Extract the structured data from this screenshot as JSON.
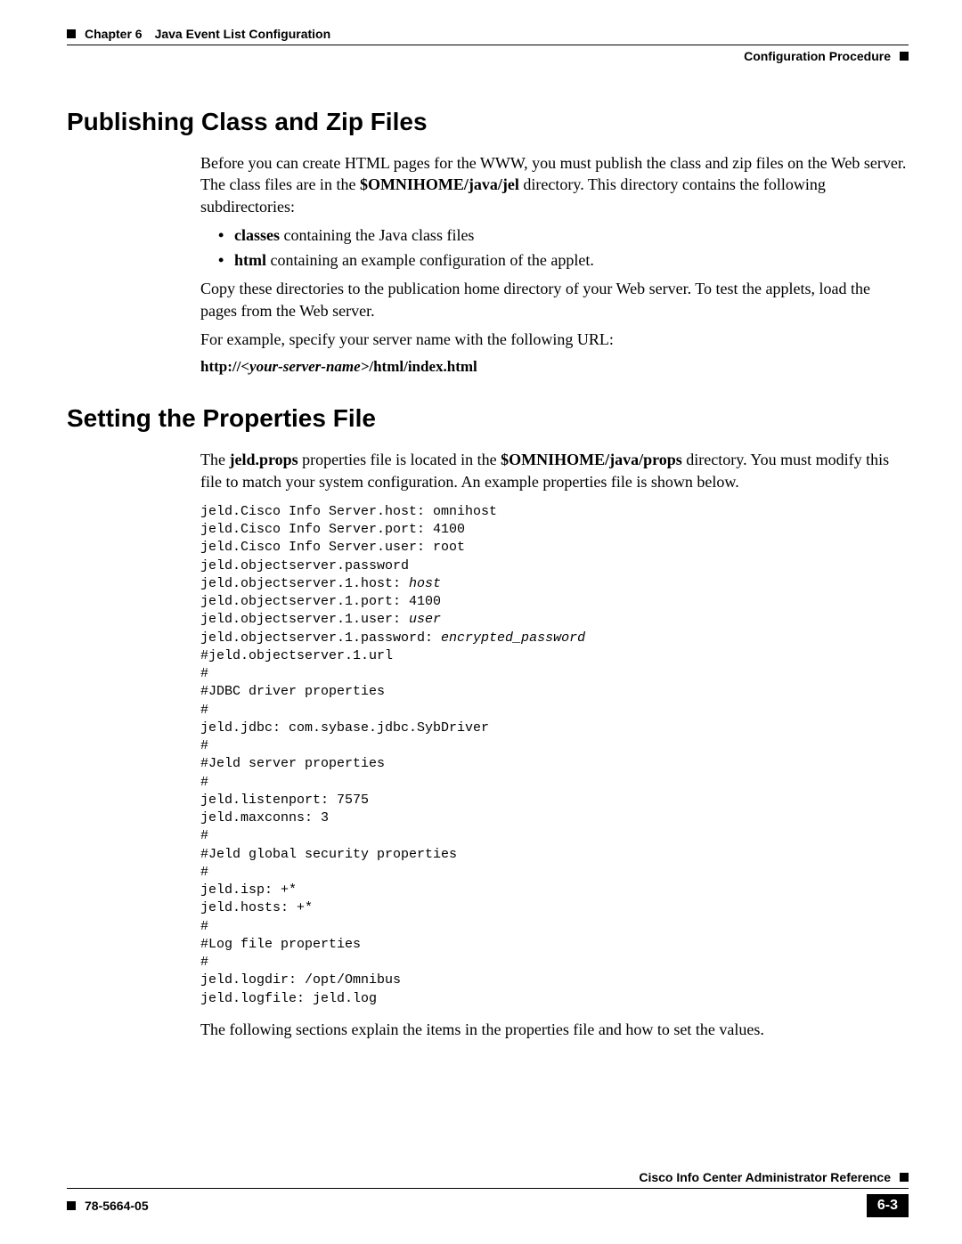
{
  "header": {
    "chapter_label": "Chapter 6",
    "chapter_title": "Java Event List Configuration",
    "section_title": "Configuration Procedure"
  },
  "section1": {
    "title": "Publishing Class and Zip Files",
    "p1_a": "Before you can create HTML pages for the WWW, you must publish the class and zip files on the Web server. The class files are in the ",
    "p1_b": "$OMNIHOME/java/jel",
    "p1_c": " directory. This directory contains the following subdirectories:",
    "li1_b": "classes",
    "li1_t": " containing the Java class files",
    "li2_b": "html",
    "li2_t": " containing an example configuration of the applet.",
    "p2": "Copy these directories to the publication home directory of your Web server. To test the applets, load the pages from the Web server.",
    "p3": "For example, specify your server name with the following URL:",
    "url_a": "http://",
    "url_b": "<your-server-name>",
    "url_c": "/html/index.html"
  },
  "section2": {
    "title": "Setting the Properties File",
    "p1_a": "The ",
    "p1_b": "jeld.props",
    "p1_c": " properties file is located in the ",
    "p1_d": "$OMNIHOME/java/props",
    "p1_e": " directory. You must modify this file to match your system configuration. An example properties file is shown below.",
    "code": {
      "l1": "jeld.Cisco Info Server.host: omnihost",
      "l2": "jeld.Cisco Info Server.port: 4100",
      "l3": "jeld.Cisco Info Server.user: root",
      "l4": "jeld.objectserver.password",
      "l5a": "jeld.objectserver.1.host: ",
      "l5b": "host",
      "l6": "jeld.objectserver.1.port: 4100",
      "l7a": "jeld.objectserver.1.user: ",
      "l7b": "user",
      "l8a": "jeld.objectserver.1.password: ",
      "l8b": "encrypted_password",
      "l9": "#jeld.objectserver.1.url",
      "l10": "#",
      "l11": "#JDBC driver properties",
      "l12": "#",
      "l13": "jeld.jdbc: com.sybase.jdbc.SybDriver",
      "l14": "#",
      "l15": "#Jeld server properties",
      "l16": "#",
      "l17": "jeld.listenport: 7575",
      "l18": "jeld.maxconns: 3",
      "l19": "#",
      "l20": "#Jeld global security properties",
      "l21": "#",
      "l22": "jeld.isp: +*",
      "l23": "jeld.hosts: +*",
      "l24": "#",
      "l25": "#Log file properties",
      "l26": "#",
      "l27": "jeld.logdir: /opt/Omnibus",
      "l28": "jeld.logfile: jeld.log"
    },
    "p2": "The following sections explain the items in the properties file and how to set the values."
  },
  "footer": {
    "doc_title": "Cisco Info Center Administrator Reference",
    "doc_num": "78-5664-05",
    "page_num": "6-3"
  }
}
